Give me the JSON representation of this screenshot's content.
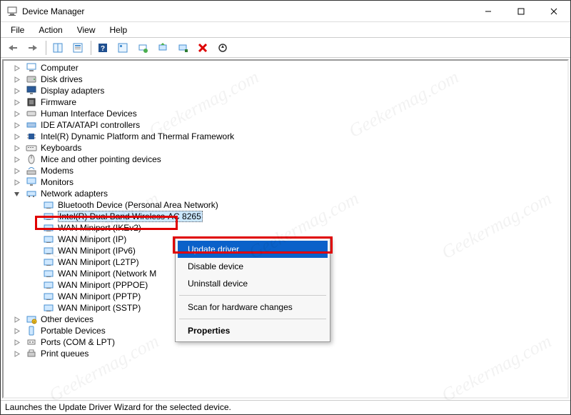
{
  "window": {
    "title": "Device Manager",
    "menus": [
      "File",
      "Action",
      "View",
      "Help"
    ]
  },
  "toolbar": {
    "items": [
      "back",
      "forward",
      "show-hidden",
      "properties",
      "help",
      "action",
      "scan",
      "update-driver",
      "uninstall",
      "disable",
      "scan-hardware"
    ]
  },
  "tree": {
    "categories": [
      {
        "icon": "computer-icon",
        "label": "Computer",
        "expander": ""
      },
      {
        "icon": "disk-icon",
        "label": "Disk drives",
        "expander": ""
      },
      {
        "icon": "display-icon",
        "label": "Display adapters",
        "expander": ""
      },
      {
        "icon": "firmware-icon",
        "label": "Firmware",
        "expander": ""
      },
      {
        "icon": "hid-icon",
        "label": "Human Interface Devices",
        "expander": ""
      },
      {
        "icon": "ide-icon",
        "label": "IDE ATA/ATAPI controllers",
        "expander": ""
      },
      {
        "icon": "chip-icon",
        "label": "Intel(R) Dynamic Platform and Thermal Framework",
        "expander": ""
      },
      {
        "icon": "keyboard-icon",
        "label": "Keyboards",
        "expander": ""
      },
      {
        "icon": "mouse-icon",
        "label": "Mice and other pointing devices",
        "expander": ""
      },
      {
        "icon": "modem-icon",
        "label": "Modems",
        "expander": ""
      },
      {
        "icon": "monitor-icon",
        "label": "Monitors",
        "expander": ""
      },
      {
        "icon": "network-icon",
        "label": "Network adapters",
        "expander": "open",
        "children": [
          {
            "icon": "net-dev-icon",
            "label": "Bluetooth Device (Personal Area Network)"
          },
          {
            "icon": "net-dev-icon",
            "label": "Intel(R) Dual Band Wireless-AC 8265",
            "selected": true,
            "highlight": true,
            "display": "Intel(R) Dual Band Wireless"
          },
          {
            "icon": "net-dev-icon",
            "label": "WAN Miniport (IKEv2)"
          },
          {
            "icon": "net-dev-icon",
            "label": "WAN Miniport (IP)"
          },
          {
            "icon": "net-dev-icon",
            "label": "WAN Miniport (IPv6)"
          },
          {
            "icon": "net-dev-icon",
            "label": "WAN Miniport (L2TP)"
          },
          {
            "icon": "net-dev-icon",
            "label": "WAN Miniport (Network M"
          },
          {
            "icon": "net-dev-icon",
            "label": "WAN Miniport (PPPOE)"
          },
          {
            "icon": "net-dev-icon",
            "label": "WAN Miniport (PPTP)"
          },
          {
            "icon": "net-dev-icon",
            "label": "WAN Miniport (SSTP)"
          }
        ]
      },
      {
        "icon": "other-icon",
        "label": "Other devices",
        "expander": ""
      },
      {
        "icon": "portable-icon",
        "label": "Portable Devices",
        "expander": ""
      },
      {
        "icon": "port-icon",
        "label": "Ports (COM & LPT)",
        "expander": ""
      },
      {
        "icon": "printer-icon",
        "label": "Print queues",
        "expander": ""
      }
    ]
  },
  "context_menu": {
    "items": [
      {
        "label": "Update driver",
        "highlight": true
      },
      {
        "label": "Disable device"
      },
      {
        "label": "Uninstall device"
      },
      {
        "sep": true
      },
      {
        "label": "Scan for hardware changes"
      },
      {
        "sep": true
      },
      {
        "label": "Properties",
        "bold": true
      }
    ]
  },
  "statusbar": {
    "text": "Launches the Update Driver Wizard for the selected device."
  },
  "watermark": "Geekermag.com",
  "chevron_right": "›",
  "chevron_down": "⌄"
}
